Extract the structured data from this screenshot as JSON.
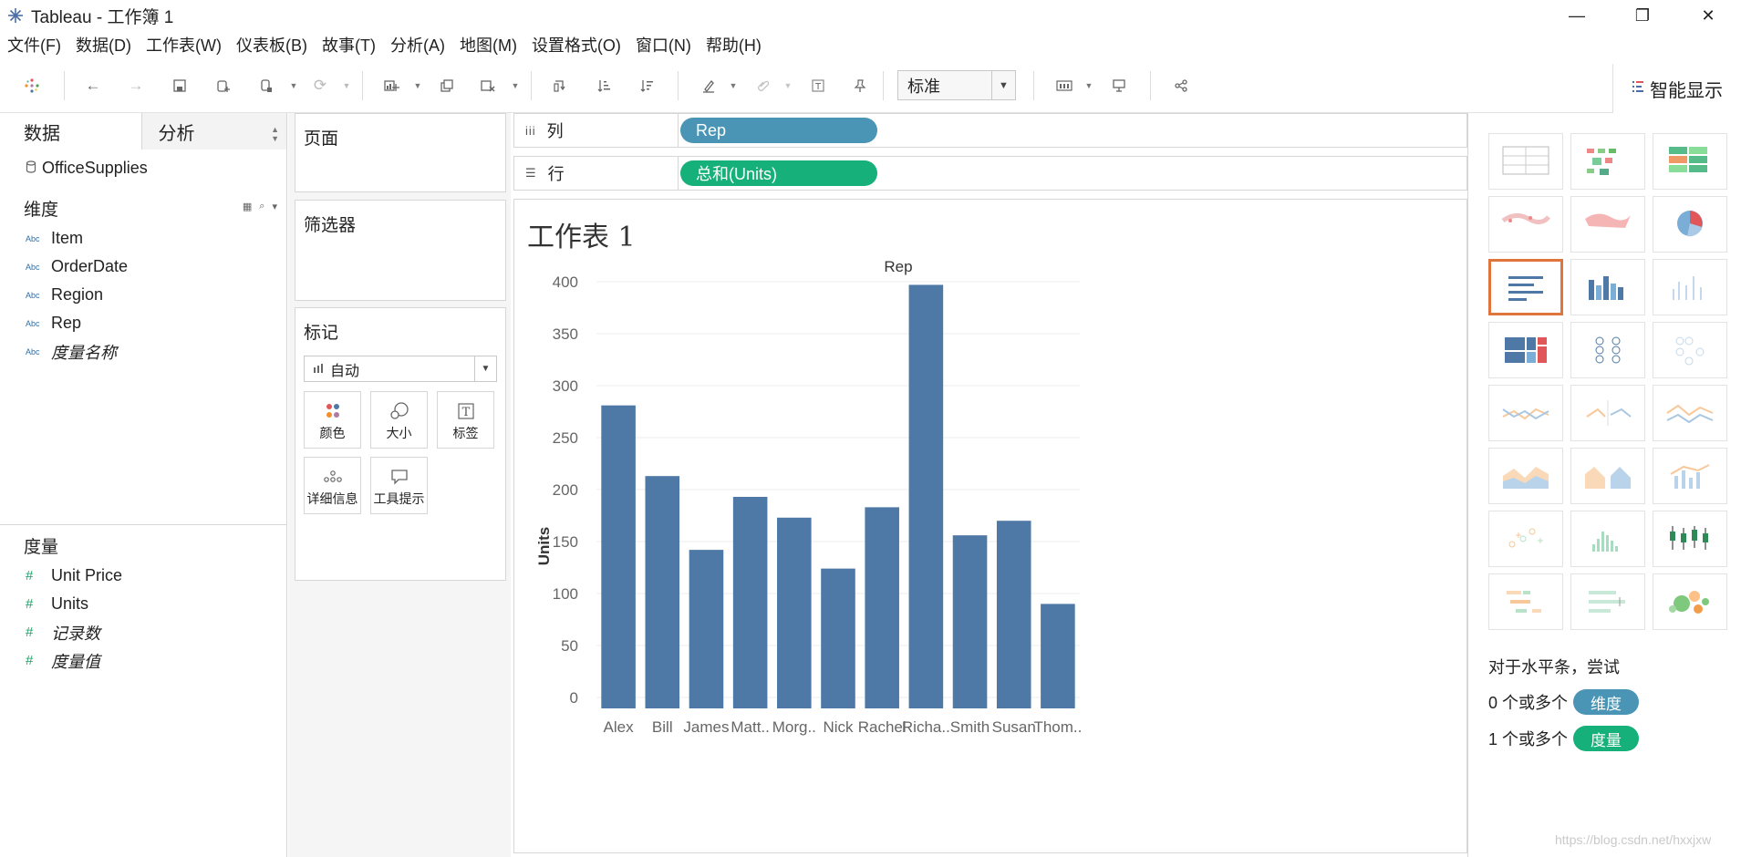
{
  "window": {
    "title": "Tableau - 工作簿 1",
    "minimize": "—",
    "maximize": "❐",
    "close": "✕"
  },
  "menu": [
    "文件(F)",
    "数据(D)",
    "工作表(W)",
    "仪表板(B)",
    "故事(T)",
    "分析(A)",
    "地图(M)",
    "设置格式(O)",
    "窗口(N)",
    "帮助(H)"
  ],
  "toolbar": {
    "fit_select": "标准",
    "show_me_label": "智能显示"
  },
  "data_panel": {
    "tabs": [
      "数据",
      "分析"
    ],
    "datasource": "OfficeSupplies",
    "dimensions_title": "维度",
    "dimensions": [
      {
        "type": "Abc",
        "name": "Item",
        "italic": false
      },
      {
        "type": "Abc",
        "name": "OrderDate",
        "italic": false
      },
      {
        "type": "Abc",
        "name": "Region",
        "italic": false
      },
      {
        "type": "Abc",
        "name": "Rep",
        "italic": false
      },
      {
        "type": "Abc",
        "name": "度量名称",
        "italic": true
      }
    ],
    "measures_title": "度量",
    "measures": [
      {
        "type": "#",
        "name": "Unit Price",
        "italic": false
      },
      {
        "type": "#",
        "name": "Units",
        "italic": false
      },
      {
        "type": "#",
        "name": "记录数",
        "italic": true
      },
      {
        "type": "#",
        "name": "度量值",
        "italic": true
      }
    ]
  },
  "cards": {
    "pages": "页面",
    "filters": "筛选器",
    "marks": "标记",
    "marks_type": "自动",
    "mark_buttons": [
      "颜色",
      "大小",
      "标签",
      "详细信息",
      "工具提示"
    ]
  },
  "shelves": {
    "columns_label": "列",
    "columns_pill": "Rep",
    "rows_label": "行",
    "rows_pill": "总和(Units)"
  },
  "sheet_title": "工作表 1",
  "chart_data": {
    "type": "bar",
    "title": "Rep",
    "xlabel": "",
    "ylabel": "Units",
    "categories": [
      "Alex",
      "Bill",
      "James",
      "Matt..",
      "Morg..",
      "Nick",
      "Rachel",
      "Richa..",
      "Smith",
      "Susan",
      "Thom.."
    ],
    "values": [
      281,
      213,
      142,
      193,
      173,
      124,
      183,
      397,
      156,
      170,
      90
    ],
    "ylim": [
      0,
      400
    ],
    "yticks": [
      0,
      50,
      100,
      150,
      200,
      250,
      300,
      350,
      400
    ],
    "bar_color": "#4e79a7",
    "grid": true
  },
  "show_me": {
    "hint_title": "对于水平条，尝试",
    "hint_dim_prefix": "0 个或多个",
    "hint_dim": "维度",
    "hint_mea_prefix": "1 个或多个",
    "hint_mea": "度量"
  },
  "watermark": "https://blog.csdn.net/hxxjxw"
}
